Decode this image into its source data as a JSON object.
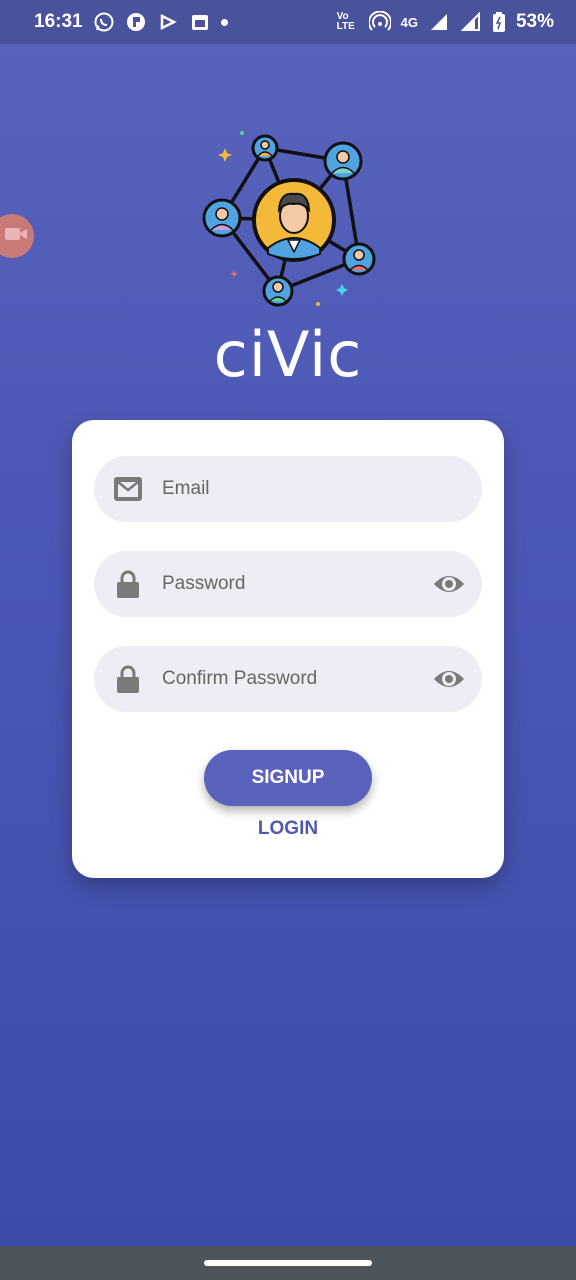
{
  "status_bar": {
    "time": "16:31",
    "network": "4G",
    "volte": "Vo LTE",
    "battery": "53%"
  },
  "app": {
    "name": "ciVic"
  },
  "form": {
    "email_placeholder": "Email",
    "password_placeholder": "Password",
    "confirm_password_placeholder": "Confirm Password",
    "signup_label": "SIGNUP",
    "login_label": "LOGIN"
  },
  "icons": {
    "email": "envelope-icon",
    "lock": "lock-icon",
    "visibility": "eye-icon",
    "logo": "network-people-icon",
    "camera": "video-camera-icon"
  },
  "colors": {
    "background": "#4d59b5",
    "primary": "#5a62bb",
    "field_bg": "#ecedf5",
    "link": "#5158ad"
  }
}
